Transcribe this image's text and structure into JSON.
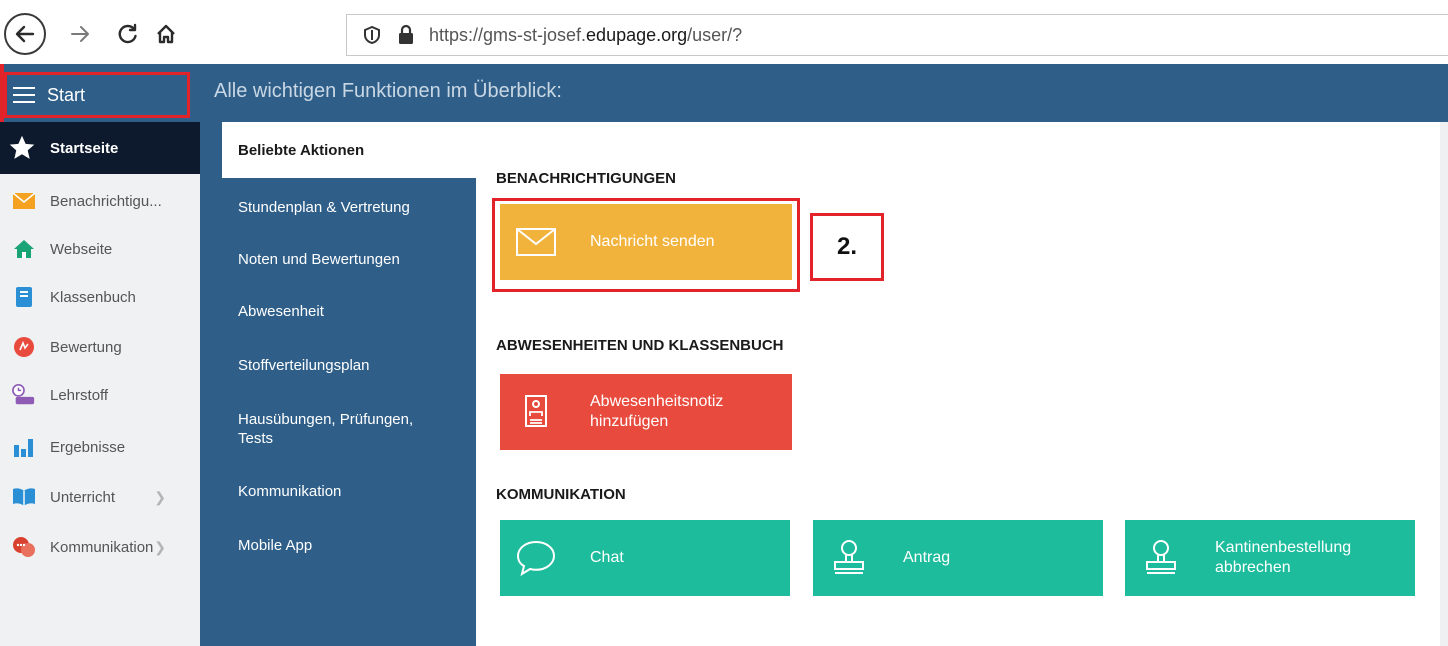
{
  "browser": {
    "url_prefix": "https://gms-st-josef.",
    "url_domain": "edupage.org",
    "url_suffix": "/user/?"
  },
  "header": {
    "menu_label": "Start",
    "title": "Alle wichtigen Funktionen im Überblick:"
  },
  "sidebar": {
    "items": [
      {
        "label": "Startseite",
        "icon": "star-icon"
      },
      {
        "label": "Benachrichtigu...",
        "icon": "envelope-icon"
      },
      {
        "label": "Webseite",
        "icon": "house-icon"
      },
      {
        "label": "Klassenbuch",
        "icon": "book-icon"
      },
      {
        "label": "Bewertung",
        "icon": "grade-icon"
      },
      {
        "label": "Lehrstoff",
        "icon": "lesson-icon"
      },
      {
        "label": "Ergebnisse",
        "icon": "bar-chart-icon"
      },
      {
        "label": "Unterricht",
        "icon": "open-book-icon"
      },
      {
        "label": "Kommunikation",
        "icon": "chat-bubbles-icon"
      }
    ]
  },
  "submenu": {
    "items": [
      "Beliebte Aktionen",
      "Stundenplan & Vertretung",
      "Noten und Bewertungen",
      "Abwesenheit",
      "Stoffverteilungsplan",
      "Hausübungen, Prüfungen, Tests",
      "Kommunikation",
      "Mobile App"
    ]
  },
  "sections": {
    "notifications": {
      "title": "BENACHRICHTIGUNGEN",
      "tile": "Nachricht senden"
    },
    "absences": {
      "title": "ABWESENHEITEN UND KLASSENBUCH",
      "tile_line1": "Abwesenheitsnotiz",
      "tile_line2": "hinzufügen"
    },
    "communication": {
      "title": "KOMMUNIKATION",
      "tiles": [
        {
          "line1": "Chat"
        },
        {
          "line1": "Antrag"
        },
        {
          "line1": "Kantinenbestellung",
          "line2": "abbrechen"
        }
      ]
    }
  },
  "annotation": {
    "label": "2."
  },
  "colors": {
    "header_blue": "#2f5f89",
    "highlight_red": "#e2242a",
    "tile_orange": "#f2b33d",
    "tile_red": "#e84b3d",
    "tile_teal": "#1dbc9c"
  }
}
